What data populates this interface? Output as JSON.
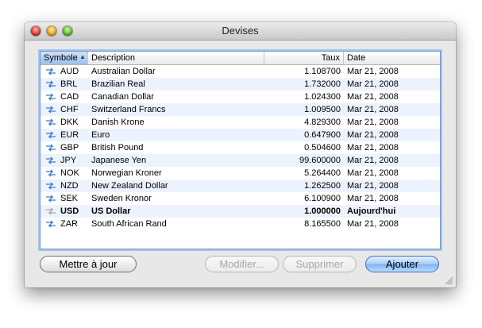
{
  "window": {
    "title": "Devises"
  },
  "table": {
    "columns": {
      "symbol": "Symbole",
      "description": "Description",
      "rate": "Taux",
      "date": "Date"
    },
    "rows": [
      {
        "symbol": "AUD",
        "description": "Australian Dollar",
        "rate": "1.108700",
        "date": "Mar 21, 2008"
      },
      {
        "symbol": "BRL",
        "description": "Brazilian Real",
        "rate": "1.732000",
        "date": "Mar 21, 2008"
      },
      {
        "symbol": "CAD",
        "description": "Canadian Dollar",
        "rate": "1.024300",
        "date": "Mar 21, 2008"
      },
      {
        "symbol": "CHF",
        "description": "Switzerland Francs",
        "rate": "1.009500",
        "date": "Mar 21, 2008"
      },
      {
        "symbol": "DKK",
        "description": "Danish Krone",
        "rate": "4.829300",
        "date": "Mar 21, 2008"
      },
      {
        "symbol": "EUR",
        "description": "Euro",
        "rate": "0.647900",
        "date": "Mar 21, 2008"
      },
      {
        "symbol": "GBP",
        "description": "British Pound",
        "rate": "0.504600",
        "date": "Mar 21, 2008"
      },
      {
        "symbol": "JPY",
        "description": "Japanese Yen",
        "rate": "99.600000",
        "date": "Mar 21, 2008"
      },
      {
        "symbol": "NOK",
        "description": "Norwegian Kroner",
        "rate": "5.264400",
        "date": "Mar 21, 2008"
      },
      {
        "symbol": "NZD",
        "description": "New Zealand Dollar",
        "rate": "1.262500",
        "date": "Mar 21, 2008"
      },
      {
        "symbol": "SEK",
        "description": "Sweden Kronor",
        "rate": "6.100900",
        "date": "Mar 21, 2008"
      },
      {
        "symbol": "USD",
        "description": "US Dollar",
        "rate": "1.000000",
        "date": "Aujourd'hui"
      },
      {
        "symbol": "ZAR",
        "description": "South African Rand",
        "rate": "8.165500",
        "date": "Mar 21, 2008"
      }
    ]
  },
  "buttons": {
    "update": "Mettre à jour",
    "edit": "Modifier...",
    "delete": "Supprimer",
    "add": "Ajouter"
  },
  "icons": {
    "rate_source": "exchange-arrows-icon",
    "sort": "sort-ascending-icon"
  },
  "colors": {
    "accent": "#3e6fb8",
    "row_alt": "#edf3fe",
    "header_selected": "#9ec0ea"
  }
}
